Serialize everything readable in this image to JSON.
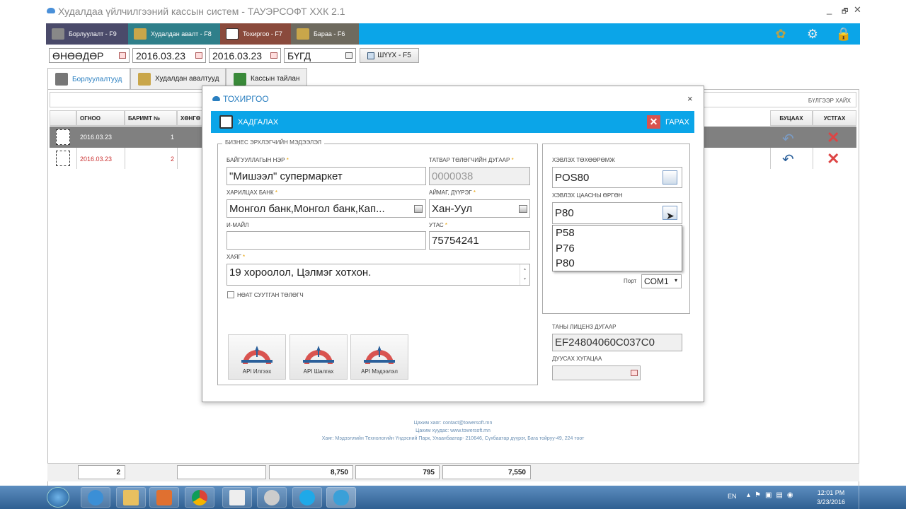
{
  "window": {
    "title": "Худалдаа үйлчилгээний кассын систем - ТАУЭРСОФТ ХХК 2.1",
    "controls": [
      "_",
      "🗗",
      "✕"
    ]
  },
  "nav": {
    "tabs": [
      {
        "label": "Борлуулалт - F9",
        "icon": "cart-icon"
      },
      {
        "label": "Худалдан авалт - F8",
        "icon": "box-icon"
      },
      {
        "label": "Тохиргоо - F7",
        "icon": "checklist-icon"
      },
      {
        "label": "Бараа - F6",
        "icon": "boxes-icon"
      }
    ],
    "active_index": 2,
    "color": "#0ba5e8"
  },
  "filters": {
    "period": "ӨНӨӨДӨР",
    "date_from": "2016.03.23",
    "date_to": "2016.03.23",
    "status": "БҮГД",
    "filter_button": "ШҮҮХ - F5"
  },
  "subtabs": [
    {
      "label": "Борлуулалтууд"
    },
    {
      "label": "Худалдан авалтууд"
    },
    {
      "label": "Кассын тайлан"
    }
  ],
  "search_label": "БҮЛГЭЭР ХАЙХ",
  "grid": {
    "headers": {
      "date": "ОГНОО",
      "receipt": "БАРИМТ №",
      "hidden": "ХӨНГӨ",
      "return": "БУЦААХ",
      "delete": "УСТГАХ"
    },
    "rows": [
      {
        "date": "2016.03.23",
        "receipt": "1"
      },
      {
        "date": "2016.03.23",
        "receipt": "2"
      }
    ]
  },
  "footer": {
    "email": "Цахим хаяг: contact@towersoft.mn",
    "web": "Цахим хуудас: www.towersoft.mn",
    "address": "Хаяг: Мэдээллийн Технологийн Үндэсний Парк, Улаанбаатар- 210646, Сүхбаатар дүүрэг, Бага тойруу-49, 224 тоот"
  },
  "totals": [
    "2",
    "",
    "8,750",
    "795",
    "7,550"
  ],
  "dialog": {
    "title": "ТОХИРГОО",
    "save_label": "ХАДГАЛАХ",
    "exit_label": "ГАРАХ",
    "business_legend": "БИЗНЕС ЭРХЛЭГЧИЙН МЭДЭЭЛЭЛ",
    "org_name_label": "БАЙГУУЛЛАГЫН НЭР",
    "org_name": "\"Мишээл\" супермаркет",
    "tax_label": "ТАТВАР ТӨЛӨГЧИЙН ДУГААР",
    "tax_value": "0000038",
    "bank_label": "ХАРИЛЦАХ БАНК",
    "bank_value": "Монгол банк,Монгол банк,Кап...",
    "district_label": "АЙМАГ, ДҮҮРЭГ",
    "district_value": "Хан-Уул",
    "email_label": "И-МАЙЛ",
    "email_value": "",
    "phone_label": "УТАС",
    "phone_value": "75754241",
    "address_label": "ХАЯГ",
    "address_value": "19 хороолол, Цэлмэг хотхон.",
    "vat_label": "НӨАТ СУУТГАН ТӨЛӨГЧ",
    "req_mark": "*",
    "api_buttons": [
      "API Илгээх",
      "API Шалгах",
      "API Мэдээлэл"
    ],
    "printer_label": "ХЭВЛЭХ ТӨХӨӨРӨМЖ",
    "printer_value": "POS80",
    "paper_label": "ХЭВЛЭХ ЦААСНЫ ӨРГӨН",
    "paper_value": "P80",
    "paper_options": [
      "P58",
      "P76",
      "P80"
    ],
    "port_label": "Порт",
    "port_value": "COM1",
    "license_label": "ТАНЫ ЛИЦЕНЗ ДУГААР",
    "license_value": "EF24804060C037C0",
    "expiry_label": "ДУУСАХ ХУГАЦАА",
    "expiry_value": ""
  },
  "taskbar": {
    "lang": "EN",
    "time": "12:01 PM",
    "date": "3/23/2016",
    "apps": [
      "start-icon",
      "ie-icon",
      "explorer-icon",
      "media-icon",
      "chrome-icon",
      "calendar-icon",
      "translate-icon",
      "skype-icon",
      "cloud-app-icon"
    ]
  }
}
